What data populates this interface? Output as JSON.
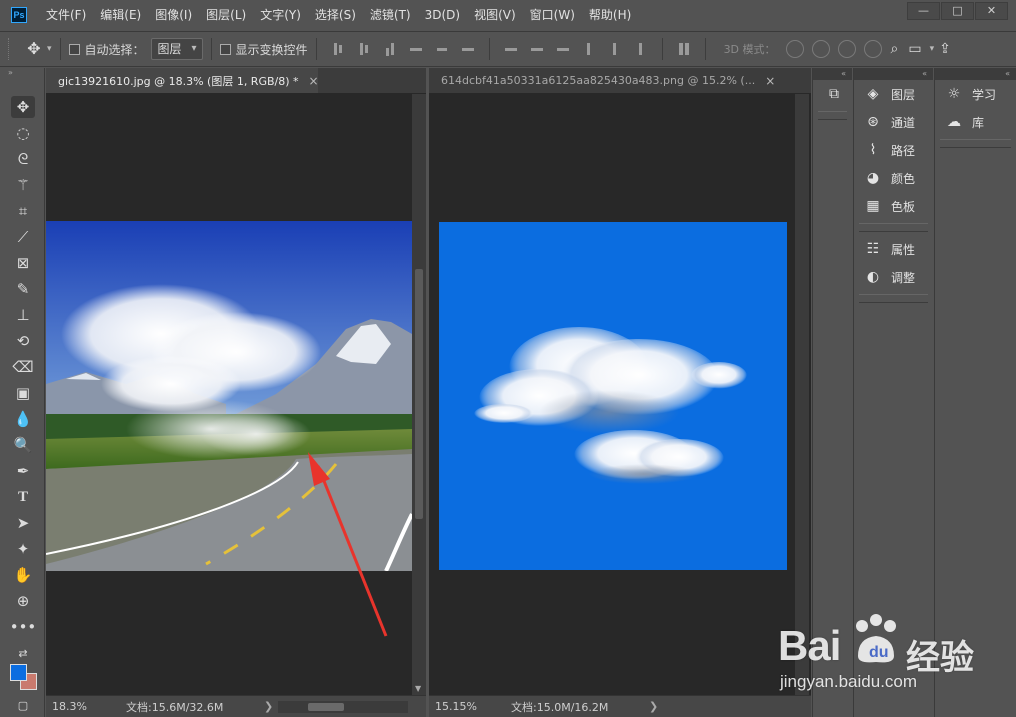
{
  "app": {
    "logo": "Ps",
    "menus": [
      "文件(F)",
      "编辑(E)",
      "图像(I)",
      "图层(L)",
      "文字(Y)",
      "选择(S)",
      "滤镜(T)",
      "3D(D)",
      "视图(V)",
      "窗口(W)",
      "帮助(H)"
    ],
    "window_buttons": {
      "minimize": "—",
      "maximize": "□",
      "close": "✕"
    }
  },
  "options": {
    "auto_select_label": "自动选择：",
    "auto_select_value": "图层",
    "show_transform_label": "显示变换控件",
    "mode_3d_label": "3D 模式："
  },
  "documents": [
    {
      "tab_title": "gic13921610.jpg @ 18.3% (图层 1, RGB/8) *",
      "close": "×",
      "zoom": "18.3%",
      "doc_size": "文档:15.6M/32.6M",
      "status_arrow": "❯"
    },
    {
      "tab_title": "614dcbf41a50331a6125aa825430a483.png @ 15.2% (...",
      "close": "×",
      "zoom": "15.15%",
      "doc_size": "文档:15.0M/16.2M",
      "status_arrow": "❯"
    }
  ],
  "panels": {
    "group1": [
      "图层",
      "通道",
      "路径",
      "颜色",
      "色板"
    ],
    "group2": [
      "属性",
      "调整"
    ],
    "group3": [
      "学习",
      "库"
    ]
  },
  "watermark": {
    "brand": "Bai",
    "brand_tail": "经验",
    "url": "jingyan.baidu.com"
  },
  "colors": {
    "foreground": "#0b6de0",
    "background": "#c97a6e",
    "sky_blue": "#0b6de0",
    "annotation_arrow": "#e8342c"
  }
}
